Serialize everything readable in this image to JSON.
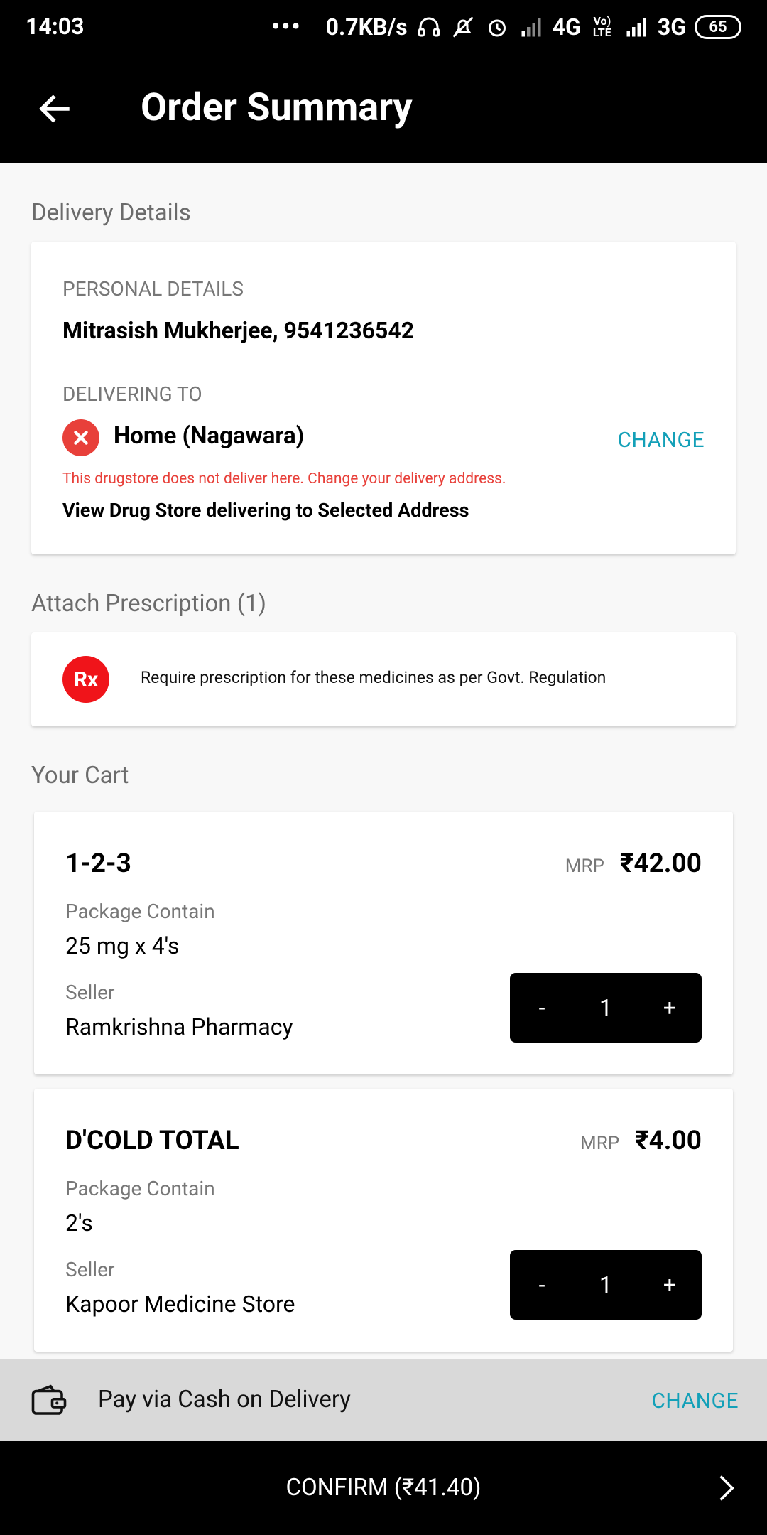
{
  "status_bar": {
    "time": "14:03",
    "dots": "•••",
    "speed": "0.7KB/s",
    "net1": "4G",
    "volte": "Vo) LTE",
    "net2": "3G",
    "battery": "65"
  },
  "app_bar": {
    "title": "Order Summary"
  },
  "delivery": {
    "section_title": "Delivery Details",
    "personal_label": "PERSONAL DETAILS",
    "personal_value": "Mitrasish Mukherjee, 9541236542",
    "delivering_label": "DELIVERING TO",
    "address": "Home (Nagawara)",
    "change_label": "CHANGE",
    "error_text": "This drugstore does not deliver here. Change your delivery address.",
    "view_stores": "View Drug Store delivering to Selected Address"
  },
  "prescription": {
    "section_title": "Attach Prescription (1)",
    "badge": "Rx",
    "text": "Require prescription for these medicines as per Govt. Regulation"
  },
  "cart": {
    "section_title": "Your Cart",
    "items": [
      {
        "name": "1-2-3",
        "mrp_label": "MRP",
        "price": "₹42.00",
        "package_label": "Package Contain",
        "package_value": "25 mg x 4's",
        "seller_label": "Seller",
        "seller_value": "Ramkrishna Pharmacy",
        "minus": "-",
        "qty": "1",
        "plus": "+"
      },
      {
        "name": "D'COLD TOTAL",
        "mrp_label": "MRP",
        "price": "₹4.00",
        "package_label": "Package Contain",
        "package_value": "2's",
        "seller_label": "Seller",
        "seller_value": "Kapoor Medicine Store",
        "minus": "-",
        "qty": "1",
        "plus": "+"
      }
    ]
  },
  "payment": {
    "label": "Pay via Cash on Delivery",
    "change_label": "CHANGE",
    "icon": "wallet-icon"
  },
  "confirm": {
    "label": "CONFIRM (₹41.40)",
    "icon": "chevron-right-icon"
  },
  "colors": {
    "accent": "#13a0b8",
    "error": "#e8403a",
    "rx": "#f0141a"
  }
}
